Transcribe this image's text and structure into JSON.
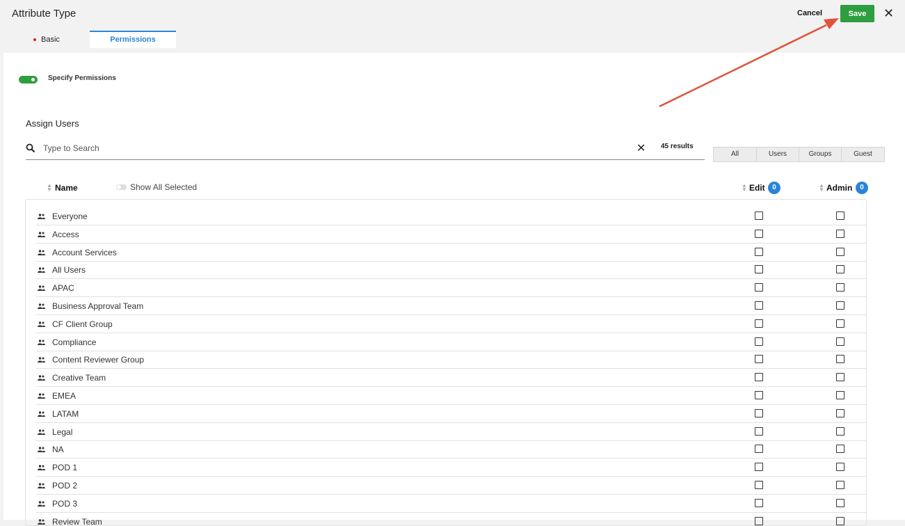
{
  "header": {
    "title": "Attribute Type",
    "cancel_label": "Cancel",
    "save_label": "Save",
    "close_icon": "close-icon"
  },
  "tabs": [
    {
      "label": "Basic",
      "active": false,
      "required_marker": true
    },
    {
      "label": "Permissions",
      "active": true
    }
  ],
  "permissions": {
    "toggle_label": "Specify Permissions",
    "toggle_on": true
  },
  "assign": {
    "title": "Assign Users",
    "search_placeholder": "Type to Search",
    "results_text": "45 results",
    "filters": [
      "All",
      "Users",
      "Groups",
      "Guest"
    ]
  },
  "table": {
    "col_name": "Name",
    "show_all_label": "Show All Selected",
    "col_edit": "Edit",
    "edit_count": "0",
    "col_admin": "Admin",
    "admin_count": "0",
    "rows": [
      "Everyone",
      "Access",
      "Account Services",
      "All Users",
      "APAC",
      "Business Approval Team",
      "CF Client Group",
      "Compliance",
      "Content Reviewer Group",
      "Creative Team",
      "EMEA",
      "LATAM",
      "Legal",
      "NA",
      "POD 1",
      "POD 2",
      "POD 3",
      "Review Team"
    ]
  },
  "colors": {
    "accent_green": "#2e9e3e",
    "accent_blue": "#2b84d6",
    "annotation_arrow": "#e0533a"
  }
}
